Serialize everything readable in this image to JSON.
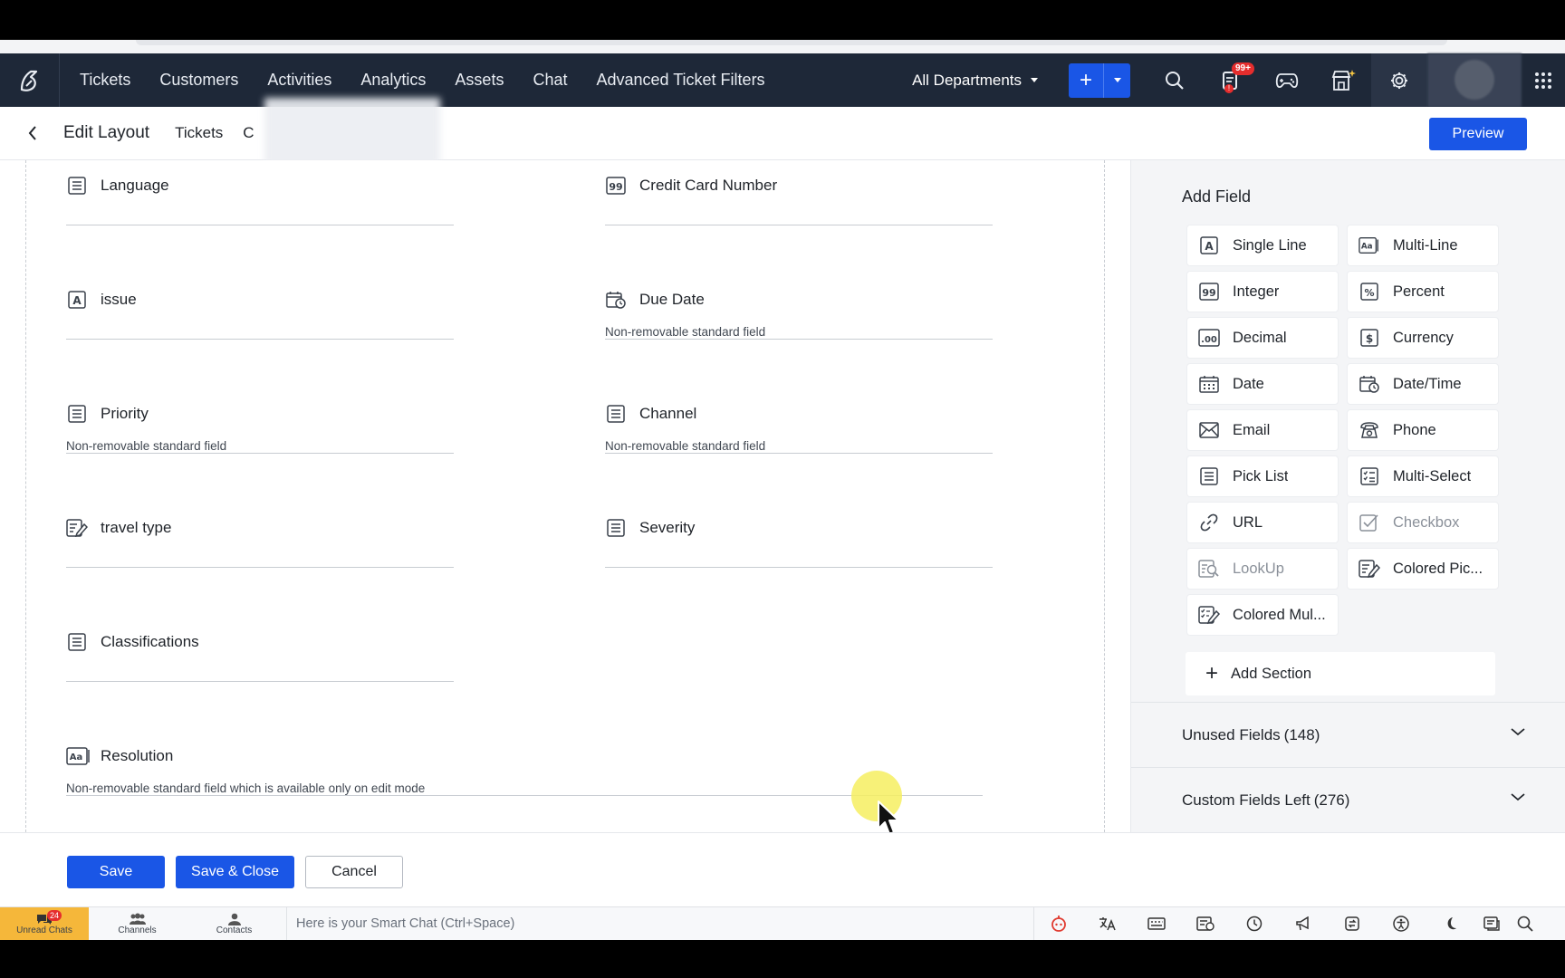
{
  "nav": {
    "items": [
      "Tickets",
      "Customers",
      "Activities",
      "Analytics",
      "Assets",
      "Chat",
      "Advanced Ticket Filters"
    ],
    "department": "All Departments",
    "notification_badge": "99+",
    "notification_dot": "!"
  },
  "subheader": {
    "title": "Edit Layout",
    "crumb": "Tickets",
    "crumb2": "C",
    "preview_label": "Preview"
  },
  "layout_fields": [
    {
      "name": "Language",
      "note": "",
      "icon": "picklist-icon"
    },
    {
      "name": "Credit Card Number",
      "note": "",
      "icon": "integer-icon"
    },
    {
      "name": "issue",
      "note": "",
      "icon": "single-line-icon"
    },
    {
      "name": "Due Date",
      "note": "Non-removable standard field",
      "icon": "datetime-icon"
    },
    {
      "name": "Priority",
      "note": "Non-removable standard field",
      "icon": "picklist-icon"
    },
    {
      "name": "Channel",
      "note": "Non-removable standard field",
      "icon": "picklist-icon"
    },
    {
      "name": "travel type",
      "note": "",
      "icon": "colored-picklist-icon"
    },
    {
      "name": "Severity",
      "note": "",
      "icon": "picklist-icon"
    },
    {
      "name": "Classifications",
      "note": "",
      "icon": "picklist-icon"
    },
    {
      "name": "Resolution",
      "note": "Non-removable standard field which is available only on edit mode",
      "icon": "multi-line-icon"
    }
  ],
  "add_field": {
    "title": "Add Field",
    "types": [
      {
        "label": "Single Line",
        "icon": "single-line-icon"
      },
      {
        "label": "Multi-Line",
        "icon": "multi-line-icon"
      },
      {
        "label": "Integer",
        "icon": "integer-icon"
      },
      {
        "label": "Percent",
        "icon": "percent-icon"
      },
      {
        "label": "Decimal",
        "icon": "decimal-icon"
      },
      {
        "label": "Currency",
        "icon": "currency-icon"
      },
      {
        "label": "Date",
        "icon": "date-icon"
      },
      {
        "label": "Date/Time",
        "icon": "datetime-icon"
      },
      {
        "label": "Email",
        "icon": "email-icon"
      },
      {
        "label": "Phone",
        "icon": "phone-icon"
      },
      {
        "label": "Pick List",
        "icon": "picklist-icon"
      },
      {
        "label": "Multi-Select",
        "icon": "multiselect-icon"
      },
      {
        "label": "URL",
        "icon": "link-icon"
      },
      {
        "label": "Checkbox",
        "icon": "checkbox-icon"
      },
      {
        "label": "LookUp",
        "icon": "lookup-icon"
      },
      {
        "label": "Colored Pic...",
        "icon": "colored-picklist-icon"
      },
      {
        "label": "Colored Mul...",
        "icon": "colored-multiselect-icon"
      }
    ],
    "add_section_label": "Add Section"
  },
  "unused_fields": {
    "label": "Unused Fields",
    "count": "(148)"
  },
  "custom_fields_left": {
    "label": "Custom Fields Left",
    "count": "(276)"
  },
  "footer": {
    "save": "Save",
    "save_close": "Save & Close",
    "cancel": "Cancel"
  },
  "bottombar": {
    "unread_chats": "Unread Chats",
    "unread_count": "24",
    "channels": "Channels",
    "contacts": "Contacts",
    "smartchat_placeholder": "Here is your Smart Chat (Ctrl+Space)"
  },
  "colors": {
    "accent": "#1a56e6",
    "nav_bg": "#1e2838",
    "badge": "#e52d2d",
    "unread_tab": "#f5b73a"
  }
}
